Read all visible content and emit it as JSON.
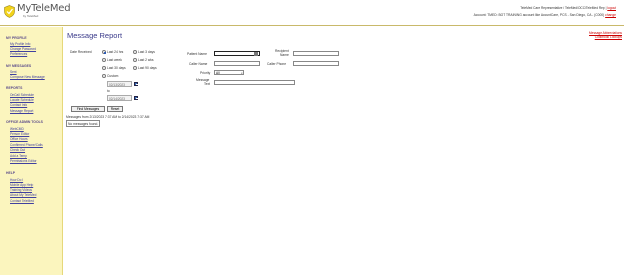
{
  "header": {
    "logo_name": "MyTeleMed",
    "logo_sub": "by TeleMed",
    "line1_prefix": "TeleMed Care Representative / TeleMed/OCC/TeleMed Rep |",
    "line1_link": "logout",
    "account_text": "Account: TMED: BOT TRAINING account like AccuntCare, PCS - San Diego, CA - (C000)",
    "account_link": "change"
  },
  "sidebar": {
    "sections": [
      {
        "title": "MY PROFILE",
        "items": [
          "My Profile Info",
          "Change Password",
          "Preferences"
        ]
      },
      {
        "title": "MY MESSAGES",
        "items": [
          "Sent",
          "Compose New Message"
        ]
      },
      {
        "title": "REPORTS",
        "items": [
          "OnCall Schedule",
          "Locate Schedule",
          "Contact Info",
          "Message Report"
        ]
      },
      {
        "title": "OFFICE ADMIN TOOLS",
        "items": [
          "WebCMD",
          "Person Editor",
          "Office Hours",
          "Confirmed Phone/Calls",
          "Check Out",
          "Add a Temp",
          "Permissions Editor"
        ]
      },
      {
        "title": "HELP",
        "items": [
          "How Do I",
          "Mobile App Help",
          "Training Videos",
          "About My TeleMed",
          "Contact TeleMed"
        ]
      }
    ]
  },
  "main": {
    "title": "Message Report",
    "right_links": [
      "Message Abbreviations",
      "Cookbook Lookups"
    ],
    "date_received_label": "Date Received",
    "radios": [
      {
        "label": "Last 24 hrs",
        "checked": true
      },
      {
        "label": "Last 3 days",
        "checked": false
      },
      {
        "label": "Last week",
        "checked": false
      },
      {
        "label": "Last 2 wks",
        "checked": false
      },
      {
        "label": "Last 30 days",
        "checked": false
      },
      {
        "label": "Last 90 days",
        "checked": false
      },
      {
        "label": "Custom",
        "checked": false
      }
    ],
    "from_date": "02/13/2023",
    "to_label": "to",
    "to_date": "02/14/2023",
    "find_button": "Find Messages",
    "reset_button": "Reset",
    "patient_name_label": "Patient Name",
    "caller_name_label": "Caller Name",
    "priority_label": "Priority",
    "priority_value": "All",
    "message_text_label_1": "Message",
    "message_text_label_2": "Text",
    "recipient_name_label_1": "Recipient",
    "recipient_name_label_2": "Name",
    "caller_phone_label": "Caller Phone",
    "results_info": "Messages from 2/13/2023 7:37 AM to 2/14/2023 7:37 AM",
    "no_results": "No messages found."
  },
  "colors": {
    "sidebar_bg": "#fbf5be",
    "title": "#3a3a8a",
    "link_red": "#cc0000",
    "link_blue": "#4040a0",
    "section": "#5a4a8a"
  },
  "icons": [
    "logo-icon",
    "calendar-icon",
    "name-picker-icon",
    "dropdown-arrow-icon"
  ]
}
